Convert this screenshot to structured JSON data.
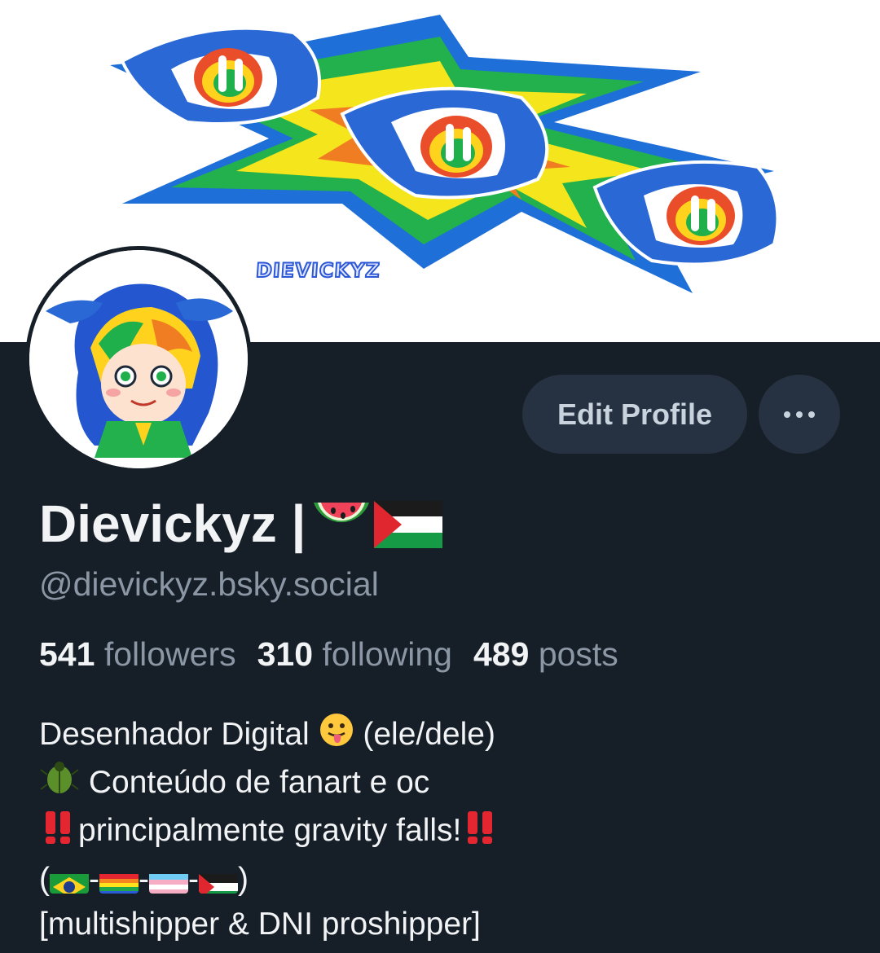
{
  "profile": {
    "banner_text": "DIEVICKYZ",
    "display_name": "Dievickyz | ",
    "handle": "@dievickyz.bsky.social",
    "edit_button_label": "Edit Profile",
    "more_button_icon": "more-horizontal-icon"
  },
  "stats": {
    "followers_count": "541",
    "followers_label": "followers",
    "following_count": "310",
    "following_label": "following",
    "posts_count": "489",
    "posts_label": "posts"
  },
  "bio": {
    "line1_a": "Desenhador Digital ",
    "line1_b": " (ele/dele)",
    "line2": " Conteúdo de fanart e oc",
    "line3": "principalmente gravity falls!",
    "line4_open": "(",
    "line4_sep": "-",
    "line4_close": ")",
    "line5": "[multishipper & DNI proshipper]"
  },
  "colors": {
    "background": "#161e27",
    "button_bg": "#263241",
    "muted_text": "#8c97a6",
    "primary_text": "#f1f3f5"
  }
}
